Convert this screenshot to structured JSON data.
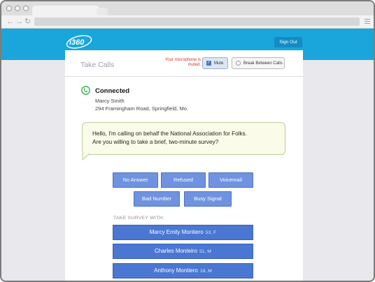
{
  "header": {
    "logo_text": "i360",
    "sign_out_label": "Sign Out",
    "brand_color": "#1aa6db"
  },
  "card": {
    "title": "Take Calls",
    "mic_warning": "Your microphone is muted.",
    "mute_label": "Mute",
    "mute_checked": true,
    "break_label": "Break Between Calls"
  },
  "call": {
    "status": "Connected",
    "caller_name": "Marcy Smith",
    "caller_address": "294 Framingham Road, Springfield, Mo.",
    "script_line1": "Hello, I'm calling on behalf the National Association for Folks.",
    "script_line2": "Are you willing to take a brief, two-minute survey?"
  },
  "dispositions": {
    "no_answer": "No Answer",
    "refused": "Refused",
    "voicemail": "Voicemail",
    "bad_number": "Bad Number",
    "busy_signal": "Busy Signal"
  },
  "survey": {
    "label": "TAKE SURVEY WITH:",
    "people": [
      {
        "name": "Marcy Emily Montiero",
        "meta": "53, F"
      },
      {
        "name": "Charles Monteiro",
        "meta": "51, M"
      },
      {
        "name": "Anthony Montiero",
        "meta": "18, M"
      }
    ]
  }
}
